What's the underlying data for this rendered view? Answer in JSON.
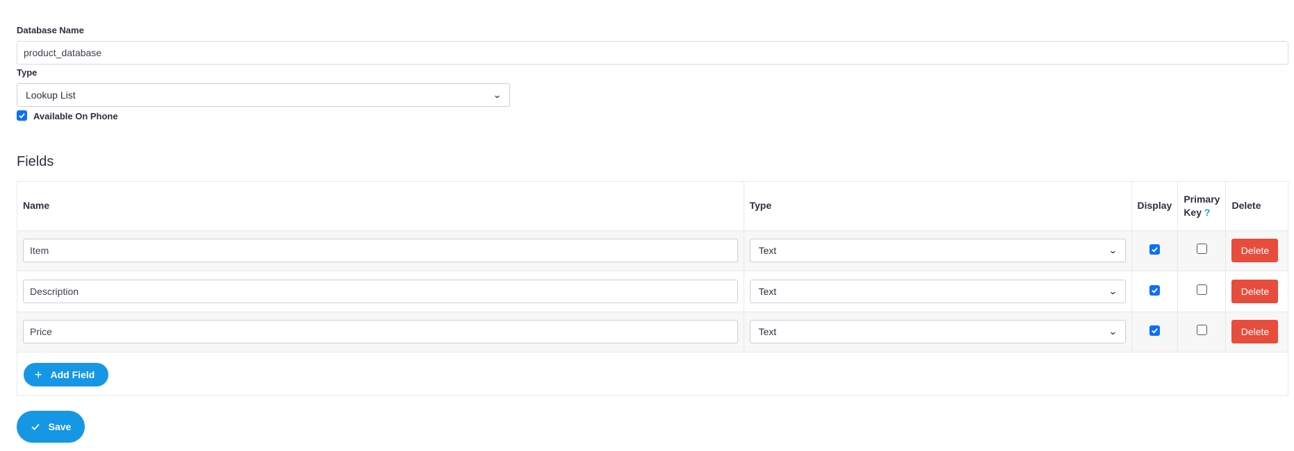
{
  "database": {
    "name_label": "Database Name",
    "name_value": "product_database",
    "type_label": "Type",
    "type_value": "Lookup List",
    "available_on_phone_label": "Available On Phone",
    "available_on_phone_checked": true
  },
  "fields_section": {
    "title": "Fields",
    "columns": {
      "name": "Name",
      "type": "Type",
      "display": "Display",
      "primary_key_line1": "Primary",
      "primary_key_line2": "Key",
      "primary_key_help": "?",
      "delete": "Delete"
    },
    "rows": [
      {
        "name": "Item",
        "type": "Text",
        "display": true,
        "primary_key": false,
        "delete_label": "Delete"
      },
      {
        "name": "Description",
        "type": "Text",
        "display": true,
        "primary_key": false,
        "delete_label": "Delete"
      },
      {
        "name": "Price",
        "type": "Text",
        "display": true,
        "primary_key": false,
        "delete_label": "Delete"
      }
    ],
    "add_field_label": "Add Field"
  },
  "save_label": "Save",
  "colors": {
    "accent_blue": "#1597e5",
    "checkbox_blue": "#0d6efd",
    "delete_red": "#e74c3c"
  },
  "icons": {
    "add": "plus-icon",
    "save": "check-icon",
    "select_caret": "chevron-down-icon"
  }
}
